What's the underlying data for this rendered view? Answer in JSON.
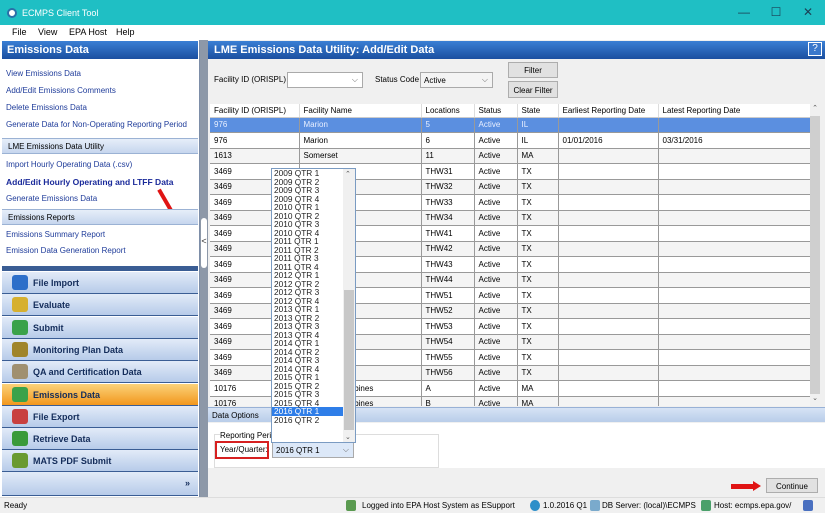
{
  "window": {
    "title": "ECMPS Client Tool",
    "min": "—",
    "max": "☐",
    "close": "✕"
  },
  "menu": [
    "File",
    "View",
    "EPA Host",
    "Help"
  ],
  "left": {
    "header": "Emissions Data",
    "links": [
      "View Emissions Data",
      "Add/Edit Emissions Comments",
      "Delete Emissions Data",
      "Generate Data for Non-Operating Reporting Period"
    ],
    "utility_section": "LME Emissions Data Utility",
    "utility_links": [
      "Import Hourly Operating Data (.csv)",
      "Add/Edit Hourly Operating and LTFF Data",
      "Generate Emissions Data"
    ],
    "reports_section": "Emissions Reports",
    "report_links": [
      "Emissions Summary Report",
      "Emission Data Generation Report"
    ],
    "nav": [
      {
        "label": "File Import",
        "icon": "file-import-icon",
        "color": "#2d6fc9"
      },
      {
        "label": "Evaluate",
        "icon": "evaluate-icon",
        "color": "#d6b030"
      },
      {
        "label": "Submit",
        "icon": "submit-icon",
        "color": "#3aa24a"
      },
      {
        "label": "Monitoring Plan Data",
        "icon": "monitoring-plan-icon",
        "color": "#a0852a"
      },
      {
        "label": "QA and Certification Data",
        "icon": "qa-certification-icon",
        "color": "#a09070"
      },
      {
        "label": "Emissions Data",
        "icon": "emissions-data-icon",
        "color": "#3aa24a",
        "active": true
      },
      {
        "label": "File Export",
        "icon": "file-export-icon",
        "color": "#c84040"
      },
      {
        "label": "Retrieve Data",
        "icon": "retrieve-data-icon",
        "color": "#3a9a3a"
      },
      {
        "label": "MATS PDF Submit",
        "icon": "mats-pdf-icon",
        "color": "#6a9a30"
      }
    ],
    "more": "»"
  },
  "main": {
    "title": "LME Emissions Data Utility: Add/Edit Data",
    "help": "?",
    "filter": {
      "facility_label": "Facility ID (ORISPL)",
      "facility_value": "",
      "status_label": "Status Code",
      "status_value": "Active",
      "filter_btn": "Filter",
      "clear_btn": "Clear Filter"
    },
    "columns": [
      "Facility ID (ORISPL)",
      "Facility Name",
      "Locations",
      "Status",
      "State",
      "Earliest Reporting Date",
      "Latest Reporting Date"
    ],
    "rows": [
      [
        "976",
        "Marion",
        "5",
        "Active",
        "IL",
        "",
        ""
      ],
      [
        "976",
        "Marion",
        "6",
        "Active",
        "IL",
        "01/01/2016",
        "03/31/2016"
      ],
      [
        "1613",
        "Somerset",
        "11",
        "Active",
        "MA",
        "",
        ""
      ],
      [
        "3469",
        "",
        "THW31",
        "Active",
        "TX",
        "",
        ""
      ],
      [
        "3469",
        "",
        "THW32",
        "Active",
        "TX",
        "",
        ""
      ],
      [
        "3469",
        "",
        "THW33",
        "Active",
        "TX",
        "",
        ""
      ],
      [
        "3469",
        "",
        "THW34",
        "Active",
        "TX",
        "",
        ""
      ],
      [
        "3469",
        "",
        "THW41",
        "Active",
        "TX",
        "",
        ""
      ],
      [
        "3469",
        "",
        "THW42",
        "Active",
        "TX",
        "",
        ""
      ],
      [
        "3469",
        "",
        "THW43",
        "Active",
        "TX",
        "",
        ""
      ],
      [
        "3469",
        "",
        "THW44",
        "Active",
        "TX",
        "",
        ""
      ],
      [
        "3469",
        "",
        "THW51",
        "Active",
        "TX",
        "",
        ""
      ],
      [
        "3469",
        "",
        "THW52",
        "Active",
        "TX",
        "",
        ""
      ],
      [
        "3469",
        "",
        "THW53",
        "Active",
        "TX",
        "",
        ""
      ],
      [
        "3469",
        "",
        "THW54",
        "Active",
        "TX",
        "",
        ""
      ],
      [
        "3469",
        "",
        "THW55",
        "Active",
        "TX",
        "",
        ""
      ],
      [
        "3469",
        "",
        "THW56",
        "Active",
        "TX",
        "",
        ""
      ],
      [
        "10176",
        "ombustion Turbines",
        "A",
        "Active",
        "MA",
        "",
        ""
      ],
      [
        "10176",
        "ombustion Turbines",
        "B",
        "Active",
        "MA",
        "",
        ""
      ]
    ],
    "data_options_tab": "Data Options",
    "reporting_period_label": "Reporting Period",
    "year_quarter_label": "Year/Quarter:",
    "year_quarter_value": "2016 QTR 1",
    "quarter_options": [
      "2009 QTR 1",
      "2009 QTR 2",
      "2009 QTR 3",
      "2009 QTR 4",
      "2010 QTR 1",
      "2010 QTR 2",
      "2010 QTR 3",
      "2010 QTR 4",
      "2011 QTR 1",
      "2011 QTR 2",
      "2011 QTR 3",
      "2011 QTR 4",
      "2012 QTR 1",
      "2012 QTR 2",
      "2012 QTR 3",
      "2012 QTR 4",
      "2013 QTR 1",
      "2013 QTR 2",
      "2013 QTR 3",
      "2013 QTR 4",
      "2014 QTR 1",
      "2014 QTR 2",
      "2014 QTR 3",
      "2014 QTR 4",
      "2015 QTR 1",
      "2015 QTR 2",
      "2015 QTR 3",
      "2015 QTR 4",
      "2016 QTR 1",
      "2016 QTR 2"
    ],
    "selected_quarter": "2016 QTR 1",
    "continue": "Continue"
  },
  "status": {
    "ready": "Ready",
    "login": "Logged into EPA Host System as ESupport",
    "version": "1.0.2016 Q1",
    "db": "DB Server: (local)\\ECMPS",
    "host": "Host: ecmps.epa.gov/"
  }
}
